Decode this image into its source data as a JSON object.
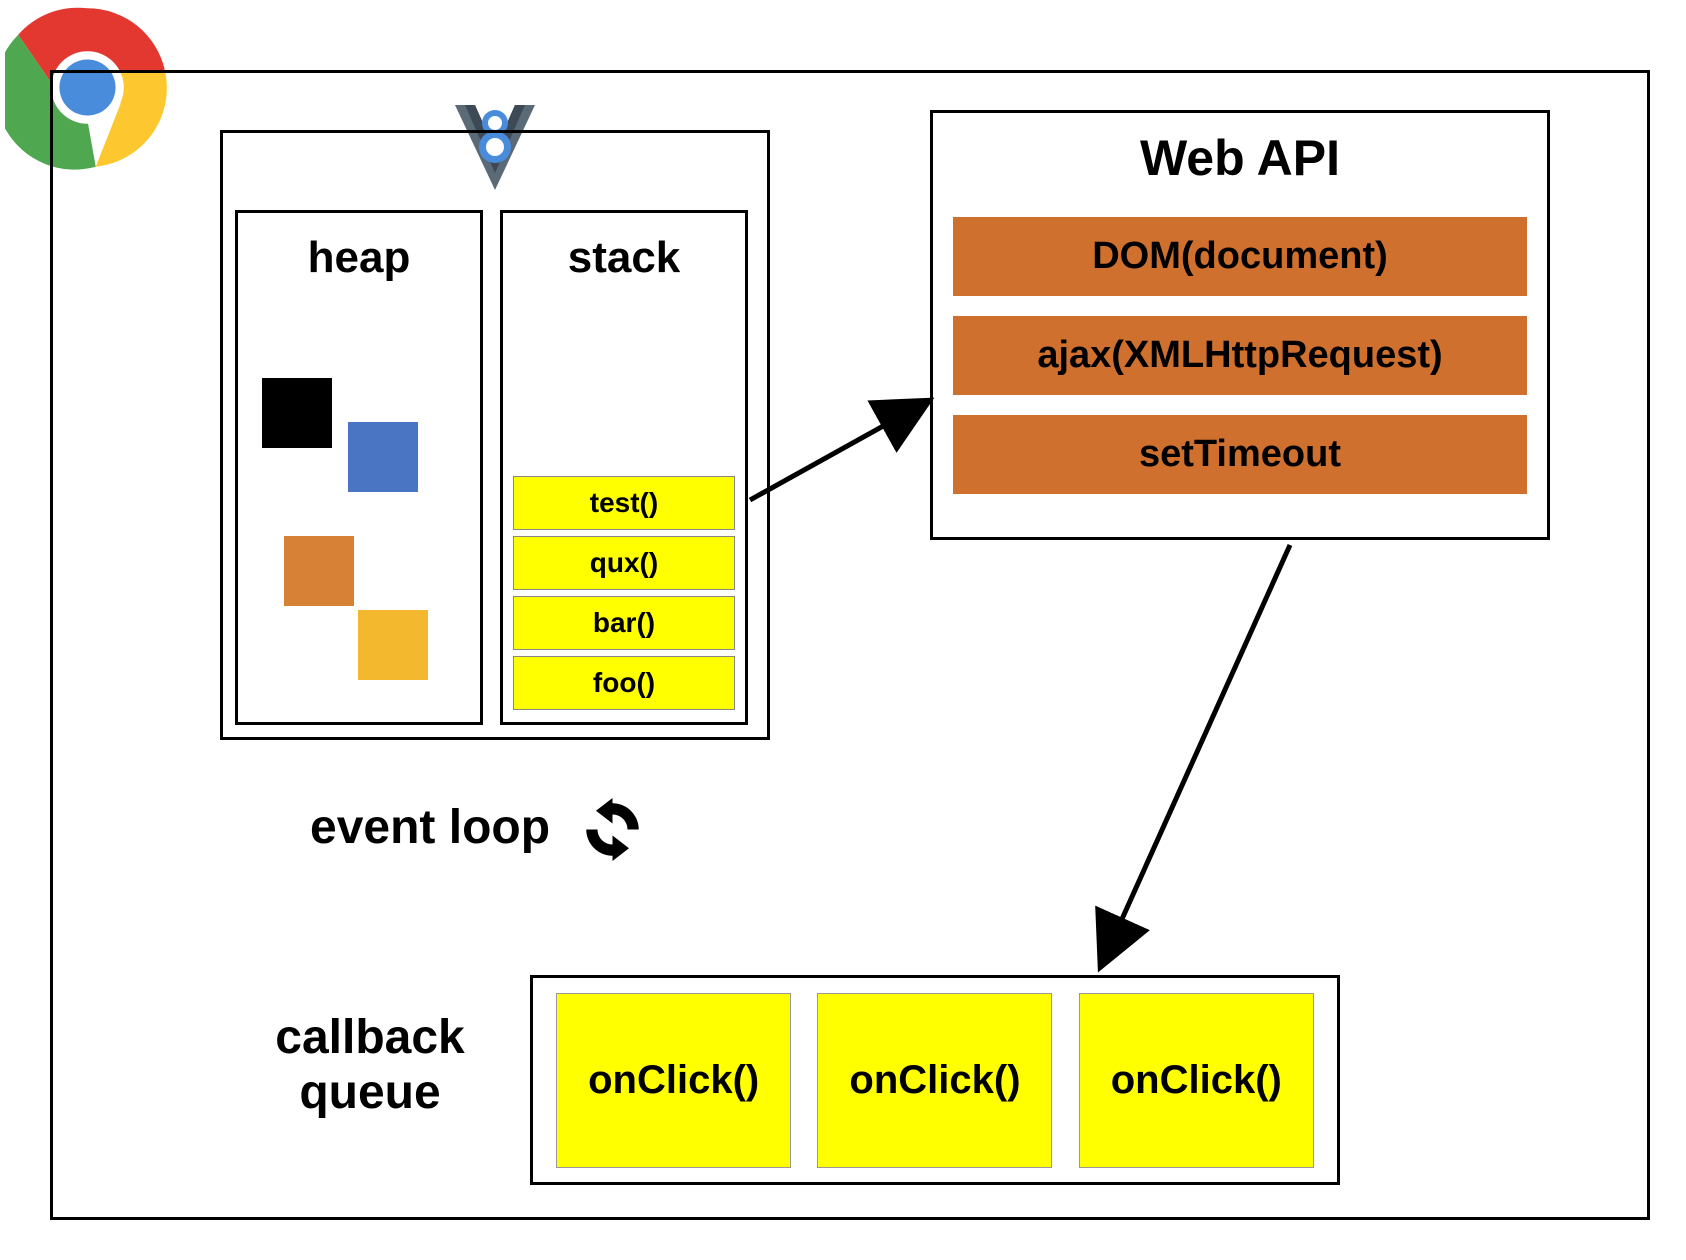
{
  "v8": {
    "heap_label": "heap",
    "stack_label": "stack",
    "stack_items": [
      "test()",
      "qux()",
      "bar()",
      "foo()"
    ]
  },
  "webapi": {
    "title": "Web API",
    "items": [
      "DOM(document)",
      "ajax(XMLHttpRequest)",
      "setTimeout"
    ]
  },
  "eventloop_label": "event loop",
  "callback_queue": {
    "label_line1": "callback",
    "label_line2": "queue",
    "items": [
      "onClick()",
      "onClick()",
      "onClick()"
    ]
  }
}
